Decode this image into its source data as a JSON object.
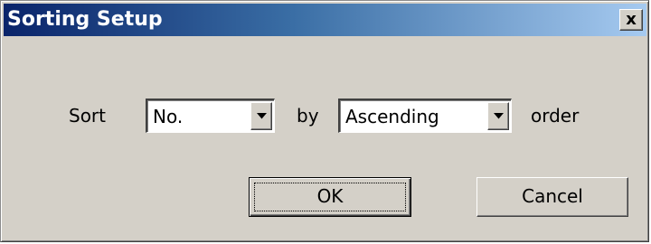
{
  "window": {
    "title": "Sorting Setup",
    "close_glyph": "✕",
    "close_label": "x"
  },
  "form": {
    "sort_label": "Sort",
    "field_select": {
      "value": "No.",
      "icon": "dropdown-arrow-icon"
    },
    "by_label": "by",
    "order_select": {
      "value": "Ascending",
      "icon": "dropdown-arrow-icon"
    },
    "order_label": "order"
  },
  "buttons": {
    "ok_label": "OK",
    "cancel_label": "Cancel"
  },
  "colors": {
    "title_gradient_start": "#0a246a",
    "title_gradient_end": "#a6caf0",
    "face": "#d4d0c8"
  }
}
